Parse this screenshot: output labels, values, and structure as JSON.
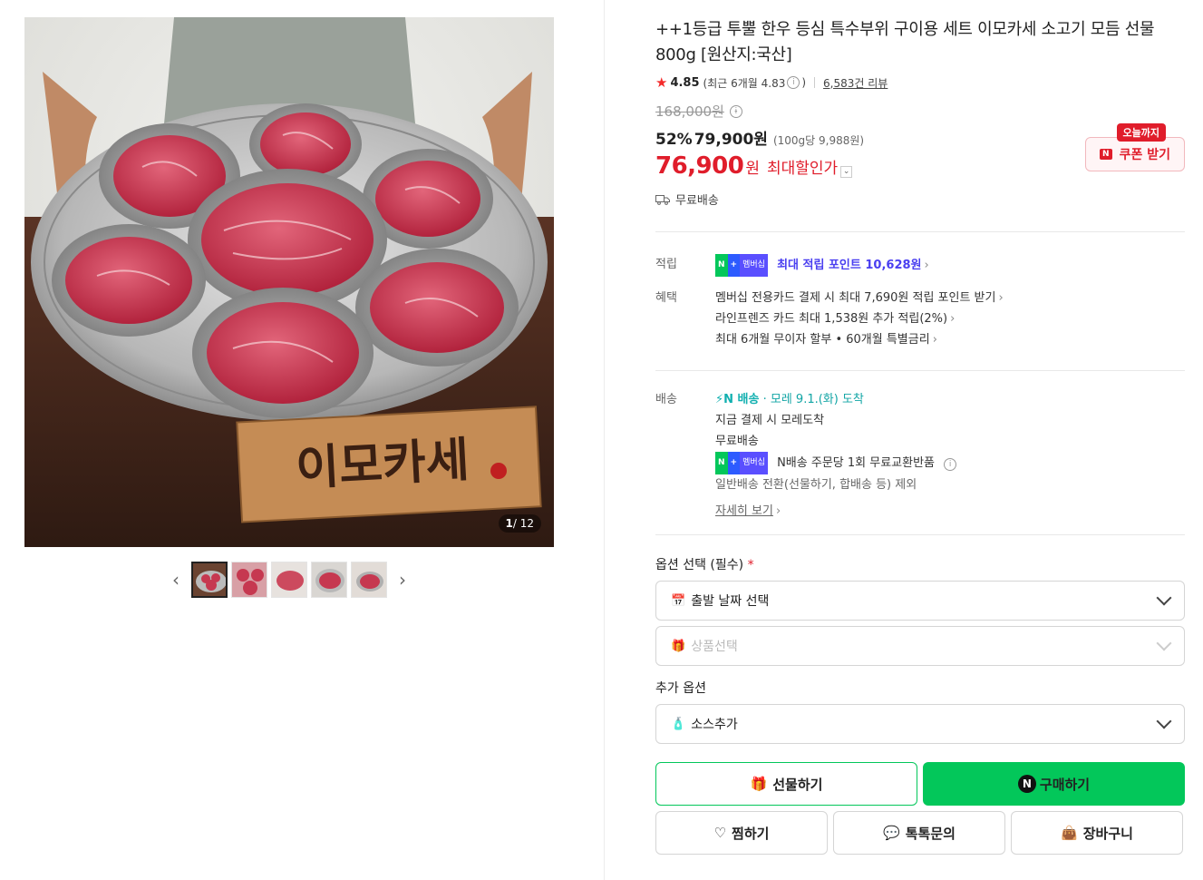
{
  "gallery": {
    "image_text": "이모카세",
    "counter_current": "1",
    "counter_total": "/ 12",
    "prev_icon": "chevron-left-icon",
    "next_icon": "chevron-right-icon"
  },
  "product": {
    "title": "++1등급 투뿔 한우 등심 특수부위 구이용 세트 이모카세 소고기 모듬 선물 800g [원산지:국산]",
    "rating": "4.85",
    "rating_recent": "(최근 6개월 4.83",
    "rating_recent_close": ")",
    "reviews": "6,583건 리뷰",
    "original_price": "168,000원",
    "discount": "52%",
    "sale_price": "79,900원",
    "unit_price": "(100g당 9,988원)",
    "best_price": "76,900",
    "best_won": "원",
    "best_label": "최대할인가",
    "free_shipping": "무료배송"
  },
  "coupon": {
    "badge": "오늘까지",
    "n": "N",
    "label": "쿠폰 받기"
  },
  "points": {
    "label": "적립",
    "badge_n": "N",
    "badge_plus": "+",
    "badge_text": "멤버십",
    "text": "최대 적립 포인트 10,628원"
  },
  "benefits": {
    "label": "혜택",
    "items": [
      "멤버십 전용카드 결제 시 최대 7,690원 적립 포인트 받기",
      "라인프렌즈 카드 최대 1,538원 추가 적립(2%)",
      "최대 6개월 무이자 할부 • 60개월 특별금리"
    ]
  },
  "delivery": {
    "label": "배송",
    "n_delivery": "배송",
    "arrival": "· 모레 9.1.(화) 도착",
    "line1": "지금 결제 시 모레도착",
    "line2": "무료배송",
    "exchange": "N배송 주문당 1회 무료교환반품",
    "exclusion": "일반배송 전환(선물하기, 합배송 등) 제외",
    "details": "자세히 보기"
  },
  "options": {
    "label": "옵션 선택 (필수)",
    "required_mark": "*",
    "date_select": "출발 날짜 선택",
    "product_select": "상품선택",
    "extra_label": "추가 옵션",
    "sauce_select": "소스추가"
  },
  "actions": {
    "gift": "선물하기",
    "buy": "구매하기",
    "buy_n": "N",
    "wish": "찜하기",
    "talk": "톡톡문의",
    "cart": "장바구니"
  },
  "colors": {
    "accent_red": "#e01d2b",
    "naver_green": "#03c75a",
    "point_purple": "#4a3ff0"
  }
}
